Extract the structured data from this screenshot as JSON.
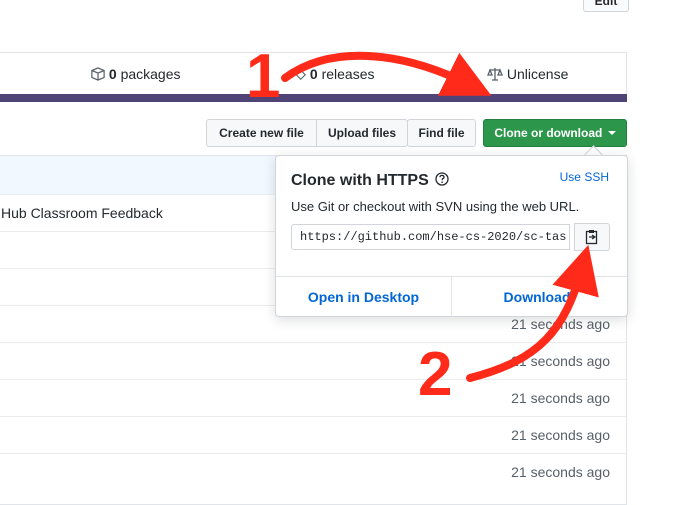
{
  "header": {
    "edit_label": "Edit"
  },
  "summary": {
    "packages_count": "0",
    "packages_label": "packages",
    "releases_count": "0",
    "releases_label": "releases",
    "license": "Unlicense"
  },
  "toolbar": {
    "create_file": "Create new file",
    "upload_files": "Upload files",
    "find_file": "Find file",
    "clone_download": "Clone or download"
  },
  "files": {
    "commit_message": "Hub Classroom Feedback",
    "rows": [
      {
        "age": "21 seconds ago"
      },
      {
        "age": "21 seconds ago"
      },
      {
        "age": "21 seconds ago"
      },
      {
        "age": "21 seconds ago"
      },
      {
        "age": "21 seconds ago"
      }
    ]
  },
  "clone_popup": {
    "title": "Clone with HTTPS",
    "use_ssh": "Use SSH",
    "description": "Use Git or checkout with SVN using the web URL.",
    "url": "https://github.com/hse-cs-2020/sc-tas",
    "open_desktop": "Open in Desktop",
    "download": "Download"
  },
  "annotations": {
    "step1": "1",
    "step2": "2"
  },
  "colors": {
    "accent_green": "#2c974b",
    "annotation_red": "#ff2a1a",
    "link_blue": "#0366d6",
    "language_bar": "#4f4475"
  }
}
